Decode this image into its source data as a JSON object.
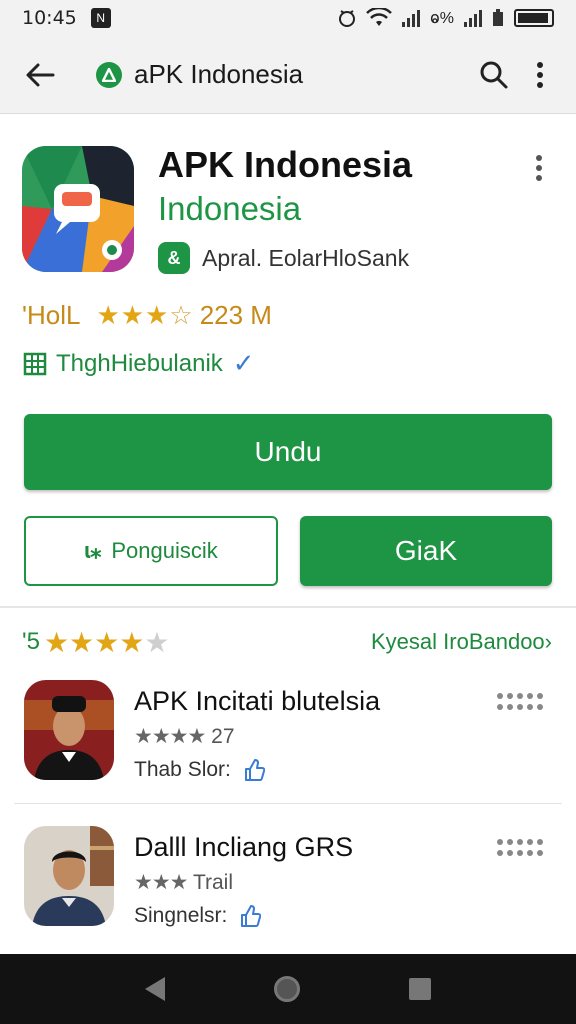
{
  "status_bar": {
    "time": "10:45",
    "extra": "ⱺ%"
  },
  "toolbar": {
    "title": "aPK Indonesia"
  },
  "app": {
    "title": "APK Indonesia",
    "subtitle": "Indonesia",
    "developer": "Apral. EolarHloSank",
    "rating_label": "'HolL",
    "stars": "★★★",
    "stars_empty": "☆",
    "rating_count": "223 M",
    "verified_label": "ThghHiebulanik",
    "install_label": "Undu",
    "secondary_label": "Ponguiscik",
    "secondary_icon": "ɩ⁎",
    "open_label": "GiaK"
  },
  "reviews": {
    "score": "'5",
    "stars": "★★★★",
    "stars_empty": "★",
    "link": "Kyesal IroBandoo",
    "link_chevron": "›",
    "items": [
      {
        "name": "APK Incitati blutelsia",
        "stars": "★★★★",
        "sub": "27",
        "meta": "Thab Slor:"
      },
      {
        "name": "Dalll Incliang GRS",
        "stars": "★★★",
        "sub": "Trail",
        "meta": "Singnelsr:"
      }
    ]
  },
  "colors": {
    "accent": "#1e9445",
    "star": "#e2a516",
    "nav": "#121212"
  }
}
